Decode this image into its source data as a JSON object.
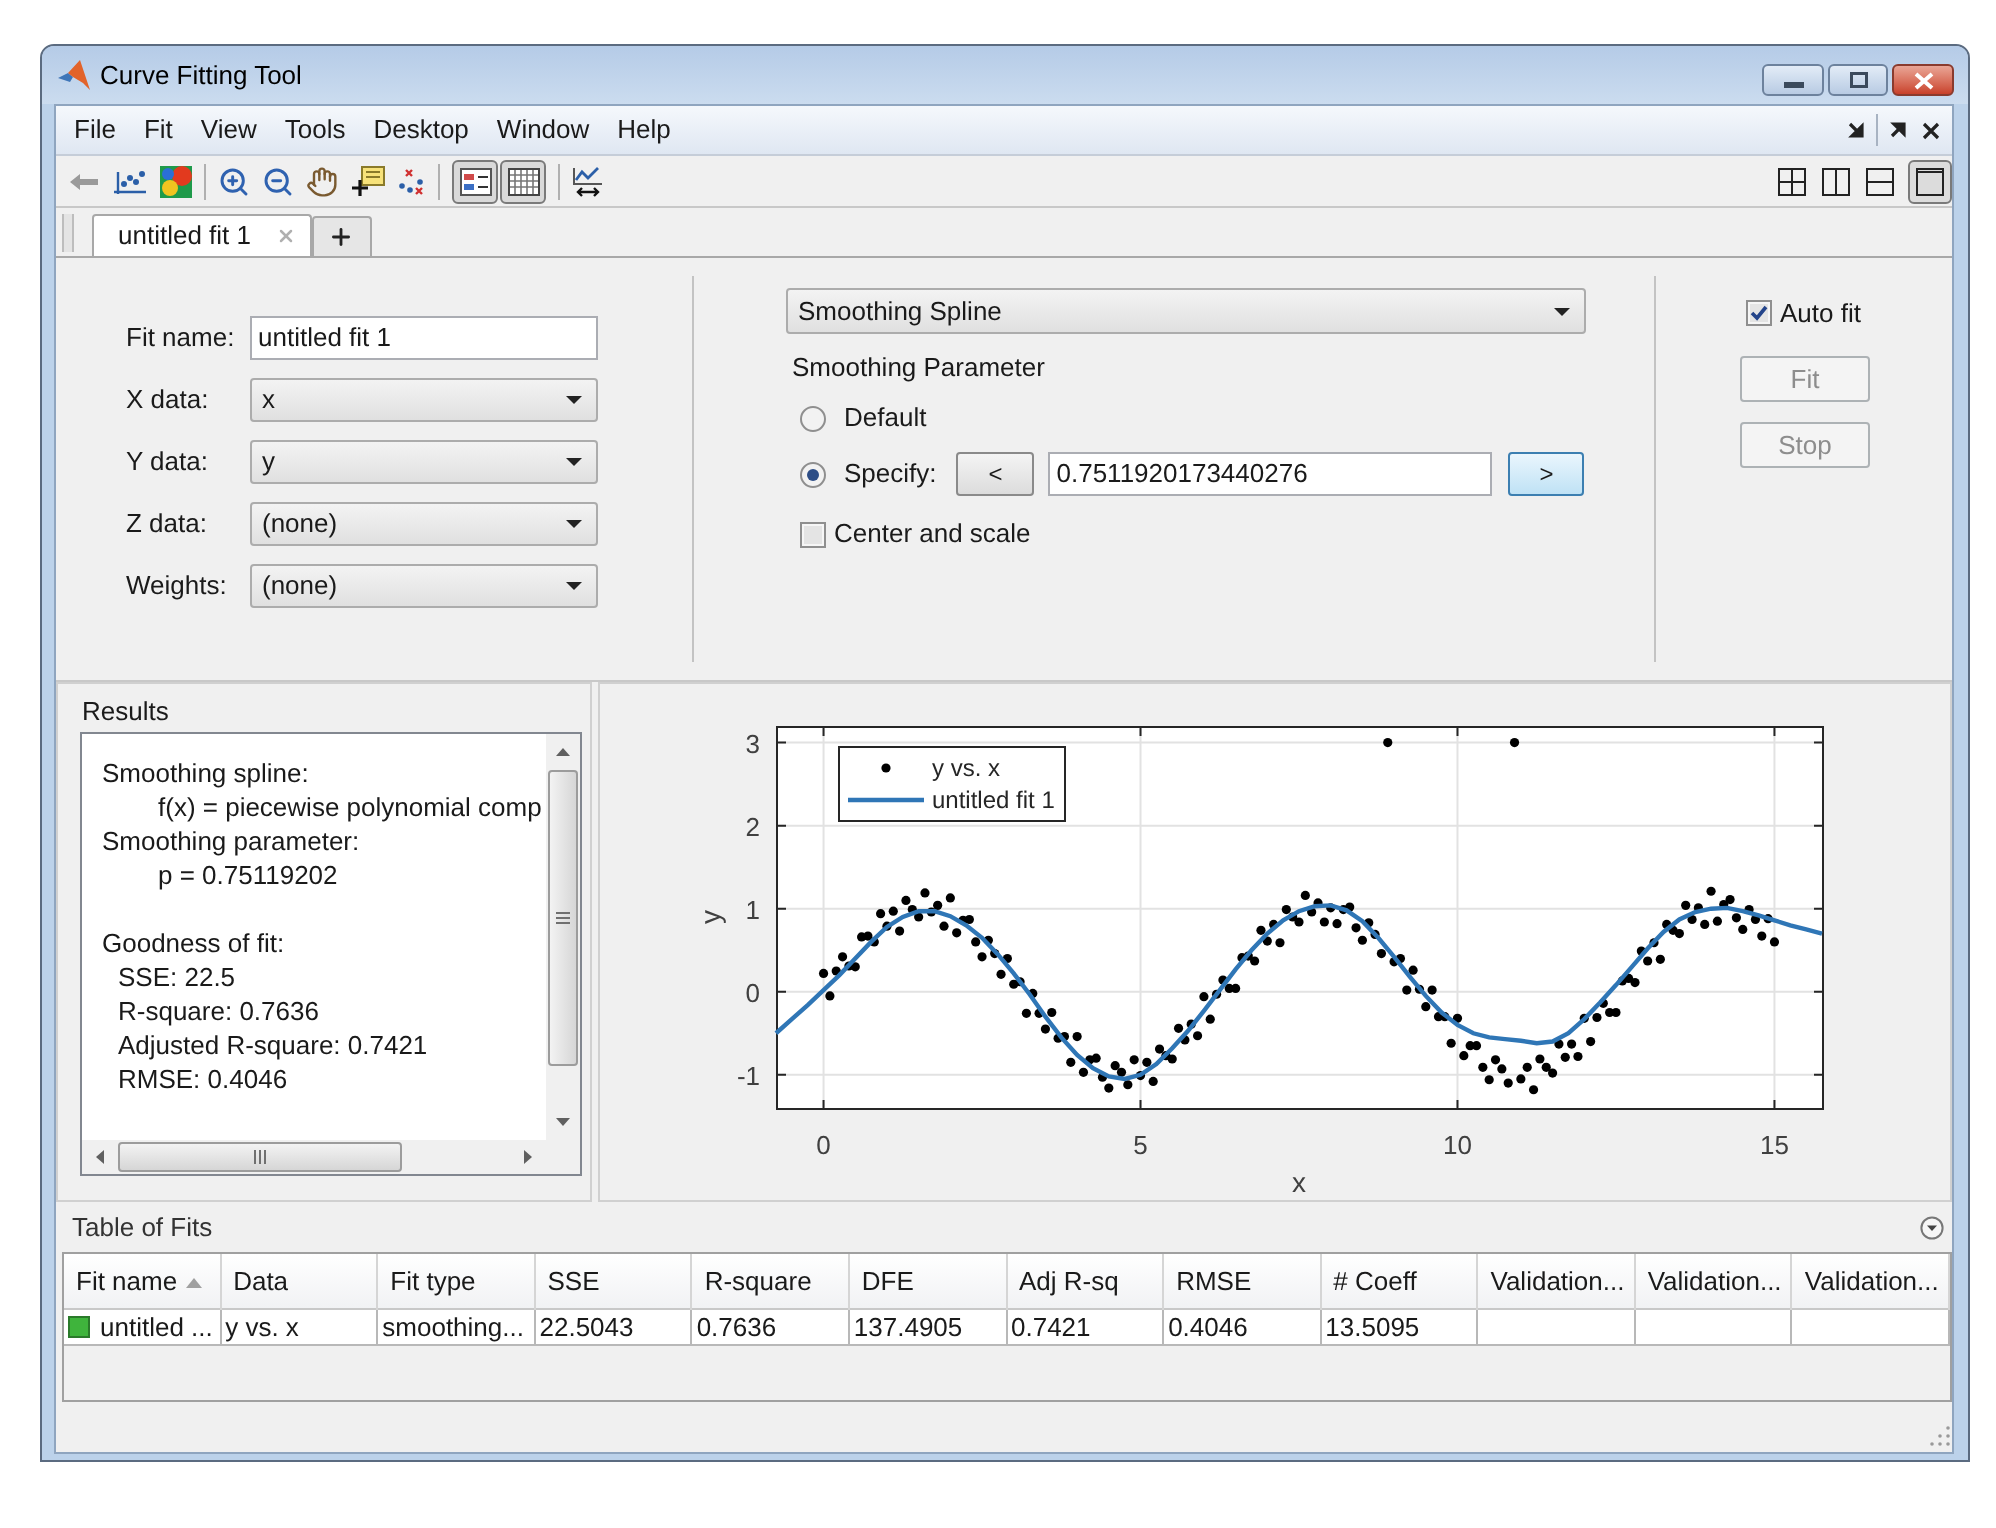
{
  "window": {
    "title": "Curve Fitting Tool"
  },
  "menu_bar": [
    "File",
    "Fit",
    "View",
    "Tools",
    "Desktop",
    "Window",
    "Help"
  ],
  "toolbar": {
    "toggles": [
      {
        "pressed": true
      },
      {
        "pressed": true
      }
    ],
    "layouts": [
      {
        "selected": false
      },
      {
        "selected": false
      },
      {
        "selected": false
      },
      {
        "selected": true
      }
    ]
  },
  "tabs": [
    {
      "label": "untitled fit 1",
      "selected": true
    }
  ],
  "fit_setup": {
    "fields": [
      {
        "label": "Fit name:",
        "kind": "text",
        "value": "untitled fit 1"
      },
      {
        "label": "X data:",
        "kind": "dropdown",
        "value": "x"
      },
      {
        "label": "Y data:",
        "kind": "dropdown",
        "value": "y"
      },
      {
        "label": "Z data:",
        "kind": "dropdown",
        "value": "(none)"
      },
      {
        "label": "Weights:",
        "kind": "dropdown",
        "value": "(none)"
      }
    ],
    "fit_type": "Smoothing Spline",
    "smoothing_parameter": {
      "label": "Smoothing Parameter",
      "options": [
        {
          "label": "Default",
          "selected": false
        },
        {
          "label": "Specify:",
          "selected": true
        }
      ],
      "decrease_button": {
        "label": "<",
        "focused": false
      },
      "value": "0.7511920173440276",
      "increase_button": {
        "label": ">",
        "focused": true
      }
    },
    "center_and_scale": {
      "label": "Center and scale",
      "checked": false
    },
    "auto_fit": {
      "label": "Auto fit",
      "checked": true
    },
    "buttons": [
      {
        "label": "Fit",
        "disabled": true
      },
      {
        "label": "Stop",
        "disabled": true
      }
    ]
  },
  "results": {
    "title": "Results",
    "sections": [
      {
        "kind": "model",
        "heading": "Smoothing spline:",
        "lines": [
          "f(x) = piecewise polynomial comp"
        ]
      },
      {
        "kind": "model",
        "heading": "Smoothing parameter:",
        "lines": [
          "p = 0.75119202"
        ]
      },
      {
        "kind": "statistics",
        "heading": "Goodness of fit:",
        "lines": [
          "SSE: 22.5",
          "R-square: 0.7636",
          "Adjusted R-square: 0.7421",
          "RMSE: 0.4046"
        ]
      }
    ]
  },
  "plot": {
    "chart_data": {
      "type": "scatter",
      "xlabel": "x",
      "ylabel": "y",
      "xlim": [
        -0.75,
        15.75
      ],
      "ylim": [
        -1.4,
        3.2
      ],
      "xticks": [
        0,
        5,
        10,
        15
      ],
      "yticks": [
        -1,
        0,
        1,
        2,
        3
      ],
      "grid": true,
      "legend": "upper left",
      "series": [
        {
          "name": "y vs. x",
          "color": "#000000",
          "x": [
            0,
            0.1,
            0.2,
            0.3,
            0.4,
            0.5,
            0.6,
            0.7,
            0.8,
            0.9,
            1,
            1.1,
            1.2,
            1.3,
            1.4,
            1.5,
            1.6,
            1.7,
            1.8,
            1.9,
            2,
            2.1,
            2.2,
            2.3,
            2.4,
            2.5,
            2.6,
            2.7,
            2.8,
            2.9,
            3,
            3.1,
            3.2,
            3.3,
            3.4,
            3.5,
            3.6,
            3.7,
            3.8,
            3.9,
            4,
            4.1,
            4.2,
            4.3,
            4.4,
            4.5,
            4.6,
            4.7,
            4.8,
            4.9,
            5,
            5.1,
            5.2,
            5.3,
            5.4,
            5.5,
            5.6,
            5.7,
            5.8,
            5.9,
            6,
            6.1,
            6.2,
            6.3,
            6.4,
            6.5,
            6.6,
            6.7,
            6.8,
            6.9,
            7,
            7.1,
            7.2,
            7.3,
            7.4,
            7.5,
            7.6,
            7.7,
            7.8,
            7.9,
            8,
            8.1,
            8.2,
            8.3,
            8.4,
            8.5,
            8.6,
            8.7,
            8.8,
            8.9,
            9,
            9.1,
            9.2,
            9.3,
            9.4,
            9.5,
            9.6,
            9.7,
            9.8,
            9.9,
            10,
            10.1,
            10.2,
            10.3,
            10.4,
            10.5,
            10.6,
            10.7,
            10.8,
            10.9,
            11,
            11.1,
            11.2,
            11.3,
            11.4,
            11.5,
            11.6,
            11.7,
            11.8,
            11.9,
            12,
            12.1,
            12.2,
            12.3,
            12.4,
            12.5,
            12.6,
            12.7,
            12.8,
            12.9,
            13,
            13.1,
            13.2,
            13.3,
            13.4,
            13.5,
            13.6,
            13.7,
            13.8,
            13.9,
            14,
            14.1,
            14.2,
            14.3,
            14.4,
            14.5,
            14.6,
            14.7,
            14.8,
            14.9,
            15
          ],
          "values": [
            0.22,
            -0.05,
            0.25,
            0.42,
            0.31,
            0.3,
            0.66,
            0.67,
            0.6,
            0.94,
            0.79,
            0.97,
            0.73,
            1.1,
            0.99,
            0.9,
            1.19,
            0.96,
            1.04,
            0.79,
            1.13,
            0.71,
            0.86,
            0.87,
            0.6,
            0.42,
            0.62,
            0.46,
            0.21,
            0.4,
            0.09,
            0.12,
            -0.26,
            -0.02,
            -0.26,
            -0.45,
            -0.25,
            -0.56,
            -0.54,
            -0.85,
            -0.54,
            -0.97,
            -0.82,
            -0.8,
            -1.03,
            -1.16,
            -0.89,
            -0.97,
            -1.12,
            -0.82,
            -1.01,
            -0.85,
            -1.08,
            -0.69,
            -0.77,
            -0.81,
            -0.44,
            -0.58,
            -0.39,
            -0.53,
            -0.06,
            -0.33,
            -0.03,
            0.14,
            0.04,
            0.04,
            0.41,
            0.43,
            0.37,
            0.74,
            0.61,
            0.81,
            0.59,
            0.99,
            0.9,
            0.84,
            1.16,
            0.96,
            1.07,
            0.84,
            1.01,
            0.82,
            0.99,
            1.02,
            0.77,
            0.62,
            0.83,
            0.69,
            0.46,
            3.0,
            0.36,
            0.4,
            0.02,
            0.26,
            0.03,
            -0.18,
            0.02,
            -0.3,
            -0.3,
            -0.62,
            -0.32,
            -0.77,
            -0.65,
            -0.65,
            -0.91,
            -1.06,
            -0.82,
            -0.93,
            -1.1,
            3.0,
            -1.05,
            -0.91,
            -1.18,
            -0.81,
            -0.91,
            -0.98,
            -0.63,
            -0.79,
            -0.63,
            -0.78,
            -0.32,
            -0.6,
            -0.31,
            -0.14,
            -0.25,
            -0.25,
            0.13,
            0.16,
            0.11,
            0.49,
            0.37,
            0.59,
            0.39,
            0.81,
            0.74,
            0.7,
            1.04,
            0.87,
            1.01,
            0.81,
            1.21,
            0.85,
            1.05,
            1.11,
            0.89,
            0.75,
            0.99,
            0.87,
            0.67,
            0.88,
            0.6
          ]
        },
        {
          "name": "untitled fit 1",
          "type": "line",
          "color": "#2f76b6",
          "x": [
            -0.75,
            -0.5,
            -0.25,
            0,
            0.25,
            0.5,
            0.75,
            1,
            1.25,
            1.5,
            1.75,
            2,
            2.25,
            2.5,
            2.75,
            3,
            3.25,
            3.5,
            3.75,
            4,
            4.25,
            4.5,
            4.75,
            5,
            5.25,
            5.5,
            5.75,
            6,
            6.25,
            6.5,
            6.75,
            7,
            7.25,
            7.5,
            7.75,
            8,
            8.25,
            8.5,
            8.75,
            9,
            9.25,
            9.5,
            9.75,
            10,
            10.25,
            10.5,
            10.75,
            11,
            11.25,
            11.5,
            11.75,
            12,
            12.25,
            12.5,
            12.75,
            13,
            13.25,
            13.5,
            13.75,
            14,
            14.25,
            14.5,
            14.75,
            15,
            15.25,
            15.5,
            15.75
          ],
          "values": [
            -0.5,
            -0.33,
            -0.16,
            0.02,
            0.2,
            0.4,
            0.6,
            0.78,
            0.9,
            0.97,
            0.97,
            0.91,
            0.8,
            0.65,
            0.45,
            0.22,
            -0.03,
            -0.3,
            -0.55,
            -0.76,
            -0.92,
            -1.02,
            -1.05,
            -1.0,
            -0.87,
            -0.68,
            -0.47,
            -0.23,
            0.02,
            0.27,
            0.5,
            0.7,
            0.86,
            0.97,
            1.03,
            1.04,
            0.98,
            0.85,
            0.65,
            0.42,
            0.18,
            -0.05,
            -0.25,
            -0.4,
            -0.5,
            -0.55,
            -0.57,
            -0.59,
            -0.62,
            -0.6,
            -0.5,
            -0.33,
            -0.13,
            0.08,
            0.3,
            0.52,
            0.72,
            0.87,
            0.96,
            1.0,
            1.01,
            0.97,
            0.92,
            0.86,
            0.8,
            0.75,
            0.7
          ]
        }
      ]
    }
  },
  "table_of_fits": {
    "title": "Table of Fits",
    "columns": [
      {
        "label": "Fit name",
        "sorted": true
      },
      {
        "label": "Data",
        "sorted": false
      },
      {
        "label": "Fit type",
        "sorted": false
      },
      {
        "label": "SSE",
        "sorted": false
      },
      {
        "label": "R-square",
        "sorted": false
      },
      {
        "label": "DFE",
        "sorted": false
      },
      {
        "label": "Adj R-sq",
        "sorted": false
      },
      {
        "label": "RMSE",
        "sorted": false
      },
      {
        "label": "# Coeff",
        "sorted": false
      },
      {
        "label": "Validation...",
        "sorted": false
      },
      {
        "label": "Validation...",
        "sorted": false
      },
      {
        "label": "Validation...",
        "sorted": false
      }
    ],
    "rows": [
      {
        "cells": [
          "untitled ...",
          "y vs. x",
          "smoothing...",
          "22.5043",
          "0.7636",
          "137.4905",
          "0.7421",
          "0.4046",
          "13.5095"
        ]
      }
    ]
  }
}
